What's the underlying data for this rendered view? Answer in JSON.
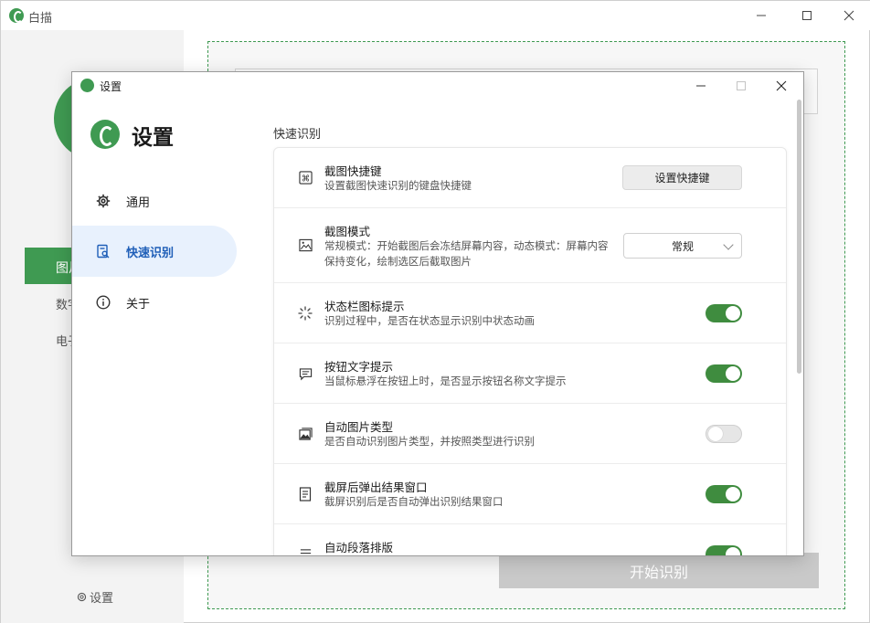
{
  "main_window": {
    "title": "白描",
    "sidebar": {
      "active_item": "图片",
      "items": [
        "数字",
        "电子"
      ],
      "settings_label": "设置"
    },
    "start_button": "开始识别"
  },
  "dialog": {
    "title": "设置",
    "heading": "设置",
    "nav": [
      {
        "label": "通用",
        "icon": "gear-icon"
      },
      {
        "label": "快速识别",
        "icon": "quick-scan-icon"
      },
      {
        "label": "关于",
        "icon": "info-icon"
      }
    ],
    "section_title": "快速识别",
    "rows": [
      {
        "title": "截图快捷键",
        "desc": "设置截图快速识别的键盘快捷键",
        "icon": "command-key-icon",
        "control": "button",
        "control_label": "设置快捷键"
      },
      {
        "title": "截图模式",
        "desc": "常规模式：开始截图后会冻结屏幕内容，动态模式：屏幕内容保持变化，绘制选区后截取图片",
        "icon": "image-icon",
        "control": "select",
        "control_value": "常规"
      },
      {
        "title": "状态栏图标提示",
        "desc": "识别过程中，是否在状态显示识别中状态动画",
        "icon": "loading-spinner-icon",
        "control": "toggle",
        "on": true
      },
      {
        "title": "按钮文字提示",
        "desc": "当鼠标悬浮在按钮上时，是否显示按钮名称文字提示",
        "icon": "message-icon",
        "control": "toggle",
        "on": true
      },
      {
        "title": "自动图片类型",
        "desc": "是否自动识别图片类型，并按照类型进行识别",
        "icon": "gallery-icon",
        "control": "toggle",
        "on": false
      },
      {
        "title": "截屏后弹出结果窗口",
        "desc": "截屏识别后是否自动弹出识别结果窗口",
        "icon": "document-icon",
        "control": "toggle",
        "on": true
      },
      {
        "title": "自动段落排版",
        "desc": "",
        "icon": "paragraph-icon",
        "control": "toggle",
        "on": true
      }
    ]
  },
  "colors": {
    "accent_green": "#3f8c3f",
    "active_nav_bg": "#e8f1fd",
    "active_nav_text": "#1f5fb8"
  }
}
